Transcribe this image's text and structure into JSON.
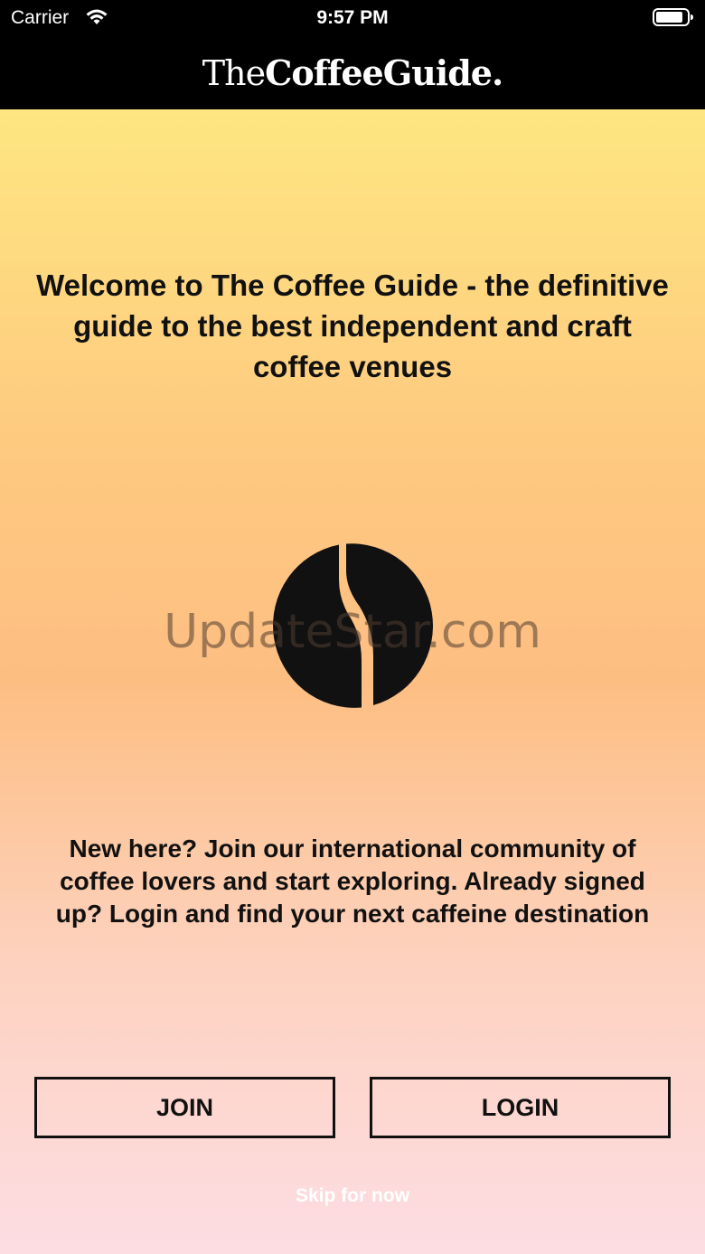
{
  "status_bar": {
    "carrier": "Carrier",
    "time": "9:57 PM",
    "icons": [
      "wifi-icon",
      "battery-icon"
    ]
  },
  "header": {
    "logo_the": "The",
    "logo_coffee_guide": "CoffeeGuide."
  },
  "main": {
    "welcome_text": "Welcome to The Coffee Guide - the definitive guide to the best independent and craft coffee venues",
    "logo_icon": "coffee-bean-icon",
    "watermark": "UpdateStar.com",
    "intro_text": "New here? Join our international community of coffee lovers and start exploring. Already signed up? Login and find your next caffeine destination"
  },
  "actions": {
    "join_label": "JOIN",
    "login_label": "LOGIN",
    "skip_label": "Skip for now"
  },
  "colors": {
    "gradient_top": "#fee681",
    "gradient_middle": "#fdbe82",
    "gradient_bottom": "#fddde3",
    "header_bg": "#000000",
    "text": "#111111"
  }
}
